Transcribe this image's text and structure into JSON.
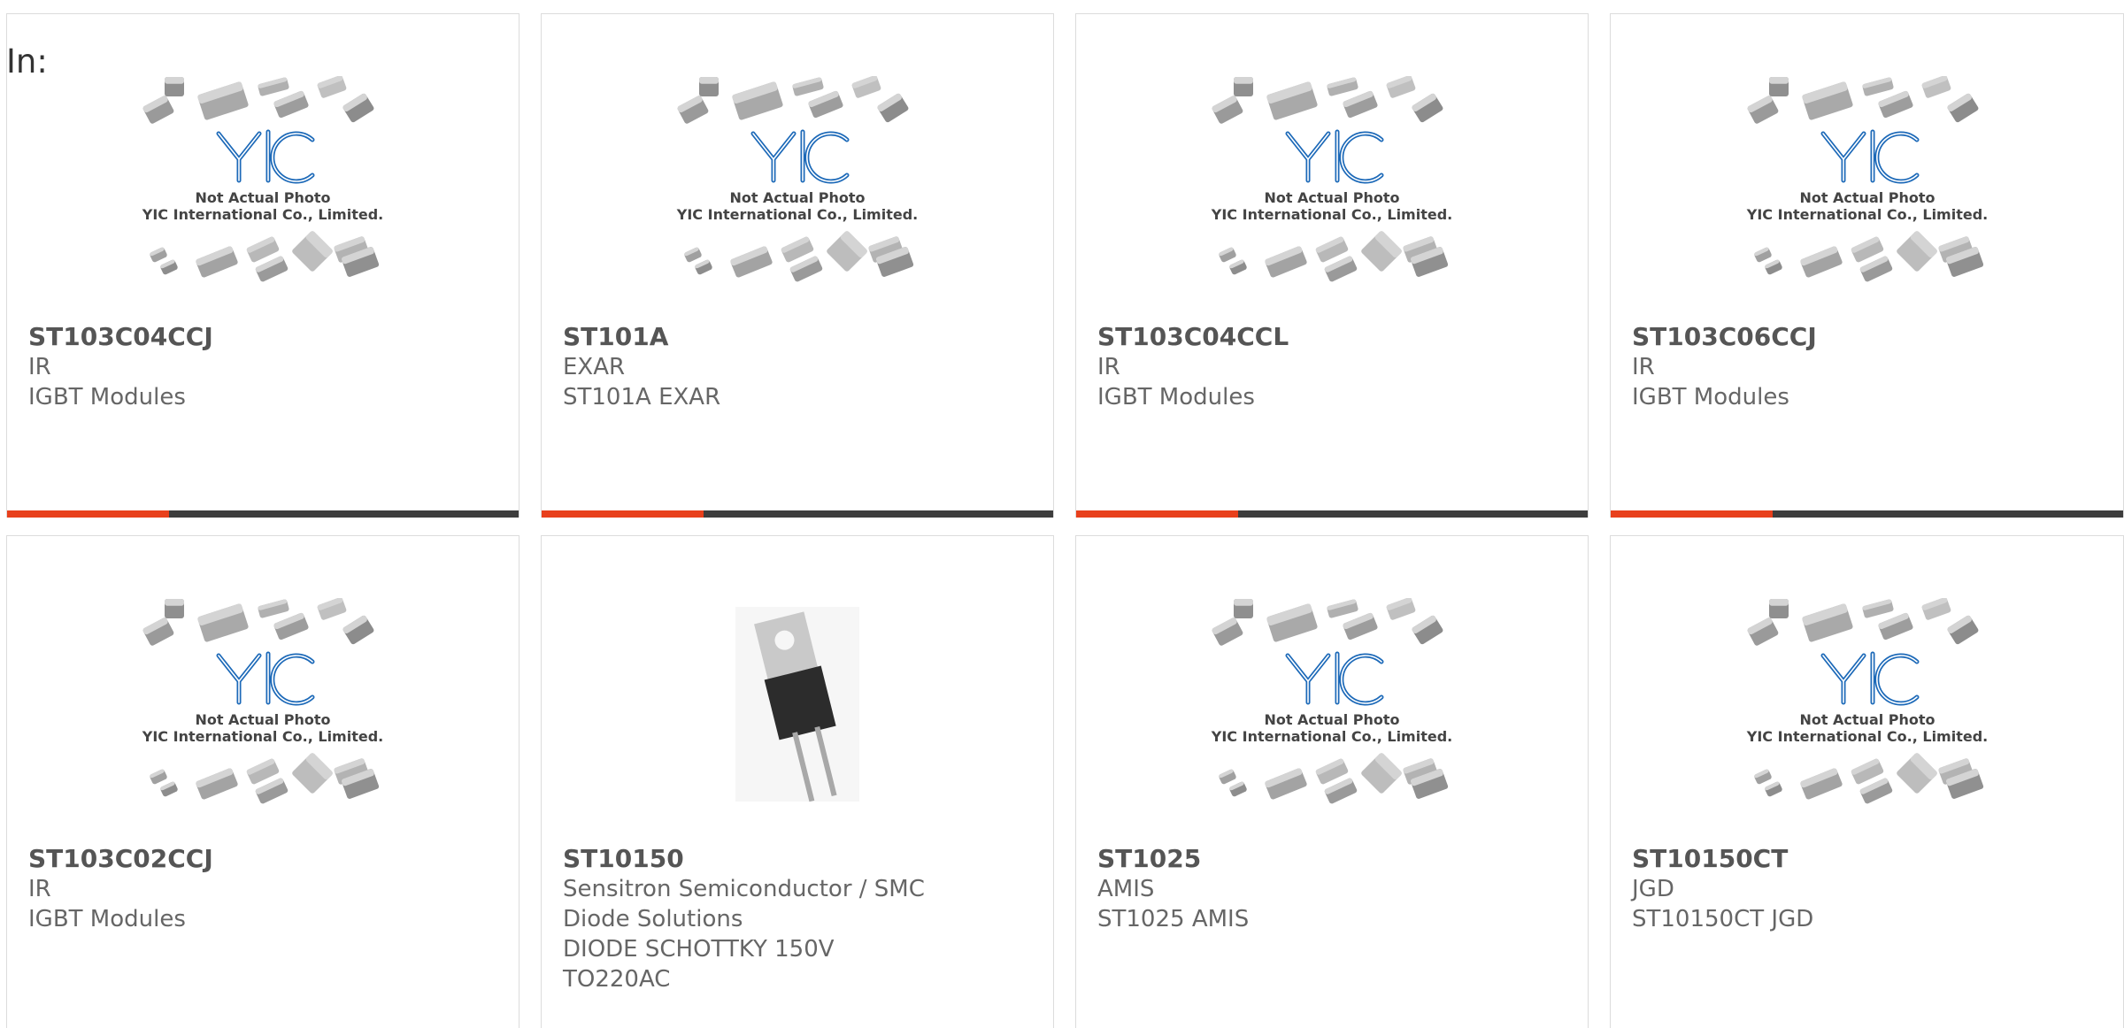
{
  "header": {
    "label": "In:"
  },
  "theme": {
    "accent": "#e8401c",
    "bar": "#3d3d3d",
    "text": "#666666",
    "border": "#dcdcdc"
  },
  "placeholder": {
    "brand": "YIC",
    "line1": "Not Actual Photo",
    "line2": "YIC International Co., Limited."
  },
  "products": [
    {
      "pn": "ST103C04CCJ",
      "lines": [
        "IR",
        "IGBT Modules"
      ],
      "image": "yic-placeholder-icon"
    },
    {
      "pn": "ST101A",
      "lines": [
        "EXAR",
        "ST101A EXAR"
      ],
      "image": "yic-placeholder-icon"
    },
    {
      "pn": "ST103C04CCL",
      "lines": [
        "IR",
        "IGBT Modules"
      ],
      "image": "yic-placeholder-icon"
    },
    {
      "pn": "ST103C06CCJ",
      "lines": [
        "IR",
        "IGBT Modules"
      ],
      "image": "yic-placeholder-icon"
    },
    {
      "pn": "ST103C02CCJ",
      "lines": [
        "IR",
        "IGBT Modules"
      ],
      "image": "yic-placeholder-icon"
    },
    {
      "pn": "ST10150",
      "lines": [
        "Sensitron Semiconductor / SMC",
        "Diode Solutions",
        "DIODE SCHOTTKY 150V",
        "TO220AC"
      ],
      "image": "to220-diode-photo"
    },
    {
      "pn": "ST1025",
      "lines": [
        "AMIS",
        "ST1025 AMIS"
      ],
      "image": "yic-placeholder-icon"
    },
    {
      "pn": "ST10150CT",
      "lines": [
        "JGD",
        "ST10150CT JGD"
      ],
      "image": "yic-placeholder-icon"
    }
  ]
}
